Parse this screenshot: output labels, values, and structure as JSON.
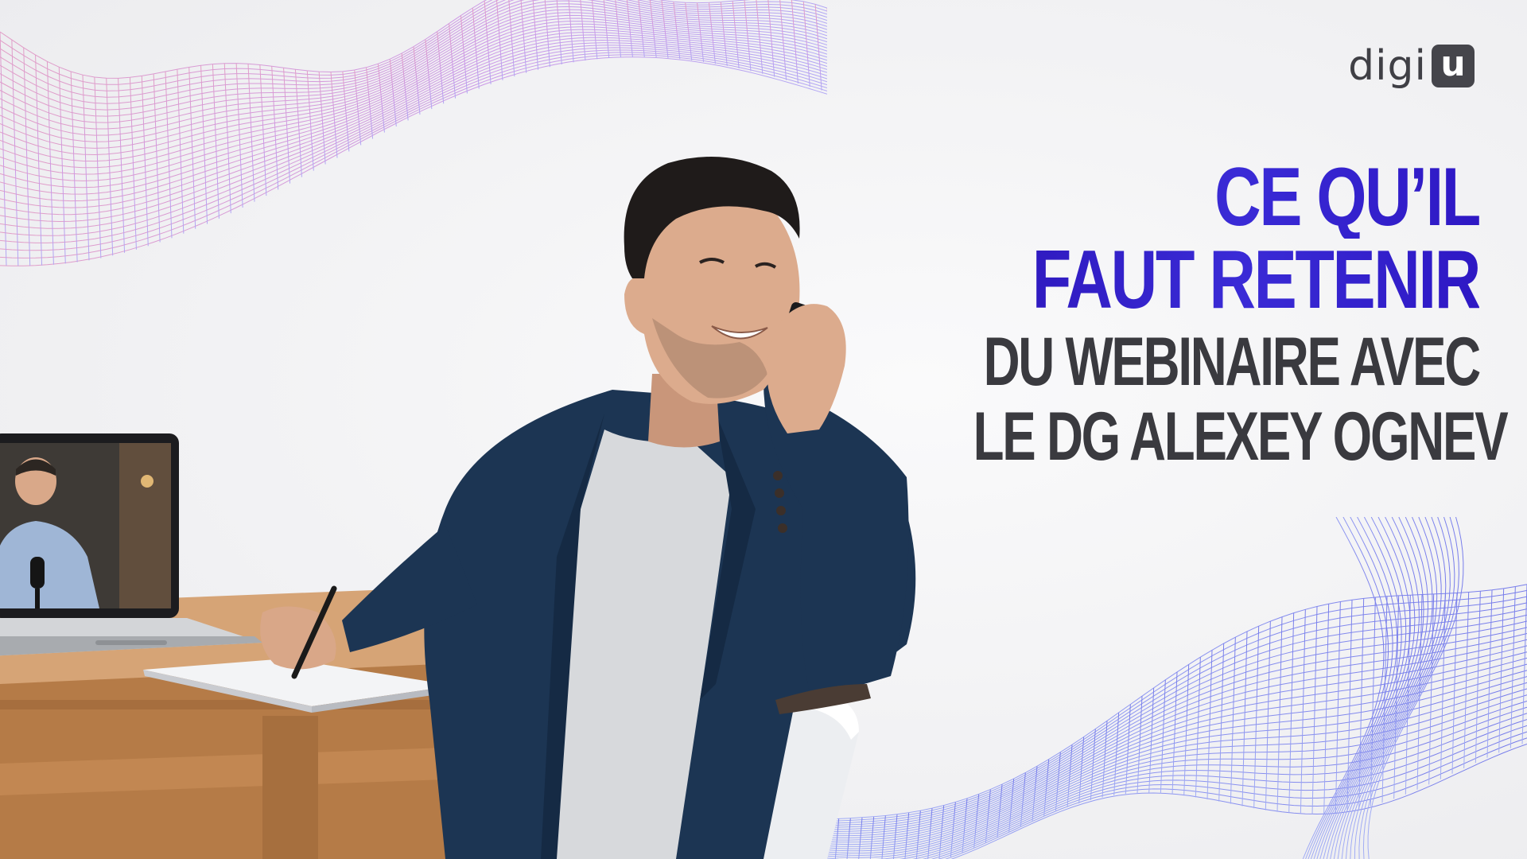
{
  "brand": {
    "logo_text": "digi",
    "logo_box_letter": "u"
  },
  "headline": {
    "line1": "CE QU’IL",
    "line2": "FAUT RETENIR",
    "line3": "DU WEBINAIRE AVEC",
    "line4": "LE DG ALEXEY OGNEV"
  },
  "colors": {
    "headline_accent": "#2b14b8",
    "headline_dark": "#3a3a3f",
    "blazer": "#1c3553",
    "desk": "#c08a55",
    "mesh_pink": "#d48ad0",
    "mesh_blue": "#6e7cf0"
  },
  "scene": {
    "subject": "man-on-phone-at-desk",
    "laptop_screen": "presenter-with-microphone"
  }
}
